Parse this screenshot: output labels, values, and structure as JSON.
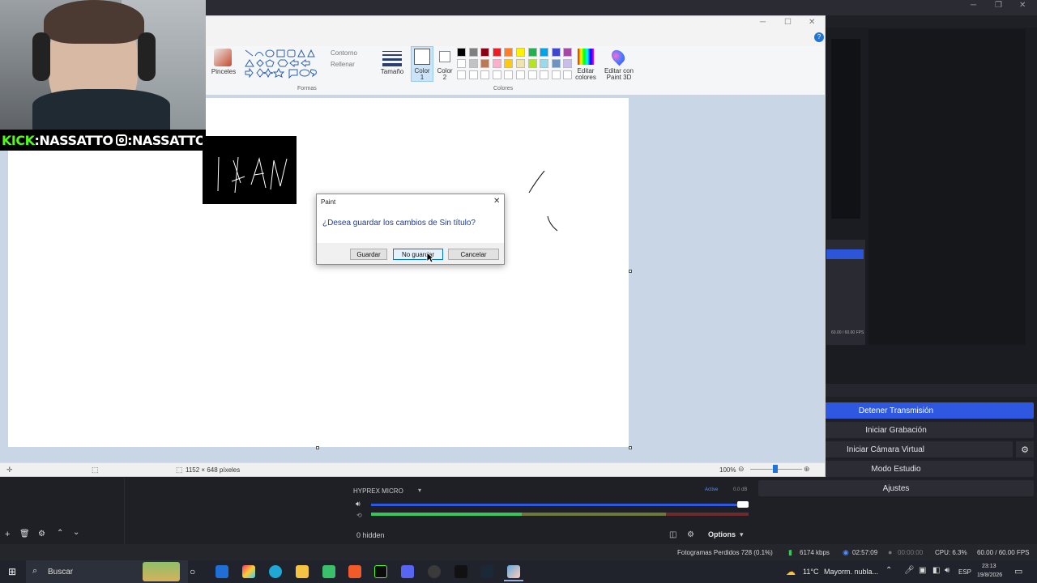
{
  "overlay": {
    "kick_label": "KICK",
    "kick_handle": ":NASSATTO",
    "ig_handle": ":NASSATTO"
  },
  "paint": {
    "ribbon": {
      "brushes": "Pinceles",
      "outline": "Contorno",
      "fill": "Rellenar",
      "shapes_group": "Formas",
      "size": "Tamaño",
      "color1": "Color\n1",
      "color2": "Color\n2",
      "colors_group": "Colores",
      "edit_colors": "Editar colores",
      "edit_paint3d": "Editar con Paint 3D",
      "palette": [
        "#000000",
        "#7f7f7f",
        "#880015",
        "#ed1c24",
        "#ff7f27",
        "#fff200",
        "#22b14c",
        "#00a2e8",
        "#3f48cc",
        "#a349a4",
        "#ffffff",
        "#c3c3c3",
        "#b97a57",
        "#ffaec9",
        "#ffc90e",
        "#efe4b0",
        "#b5e61d",
        "#99d9ea",
        "#7092be",
        "#c8bfe7"
      ]
    },
    "status": {
      "dimensions": "1152 × 648 píxeles",
      "zoom": "100%"
    }
  },
  "dialog": {
    "title": "Paint",
    "message": "¿Desea guardar los cambios de Sin título?",
    "save": "Guardar",
    "dont_save": "No guardar",
    "cancel": "Cancelar"
  },
  "obs": {
    "controls": {
      "stop_stream": "Detener Transmisión",
      "start_recording": "Iniciar Grabación",
      "start_virtual_cam": "Iniciar Cámara Virtual",
      "studio_mode": "Modo Estudio",
      "settings": "Ajustes"
    },
    "mixer": {
      "source": "HYPREX MICRO",
      "active": "Active",
      "level": "0.0 dB",
      "hidden": "0 hidden",
      "options": "Options"
    },
    "mini_fps": "60.00 / 60.00 FPS",
    "status": {
      "dropped": "Fotogramas Perdidos 728 (0.1%)",
      "bitrate": "6174 kbps",
      "stream_time": "02:57:09",
      "rec_time": "00:00:00",
      "cpu": "CPU: 6.3%",
      "fps": "60.00 / 60.00 FPS"
    }
  },
  "taskbar": {
    "search": "Buscar",
    "weather": "11°C",
    "weather_desc": "Mayorm. nubla...",
    "lang": "ESP",
    "time": "23:13",
    "date": "19/8/2026"
  }
}
